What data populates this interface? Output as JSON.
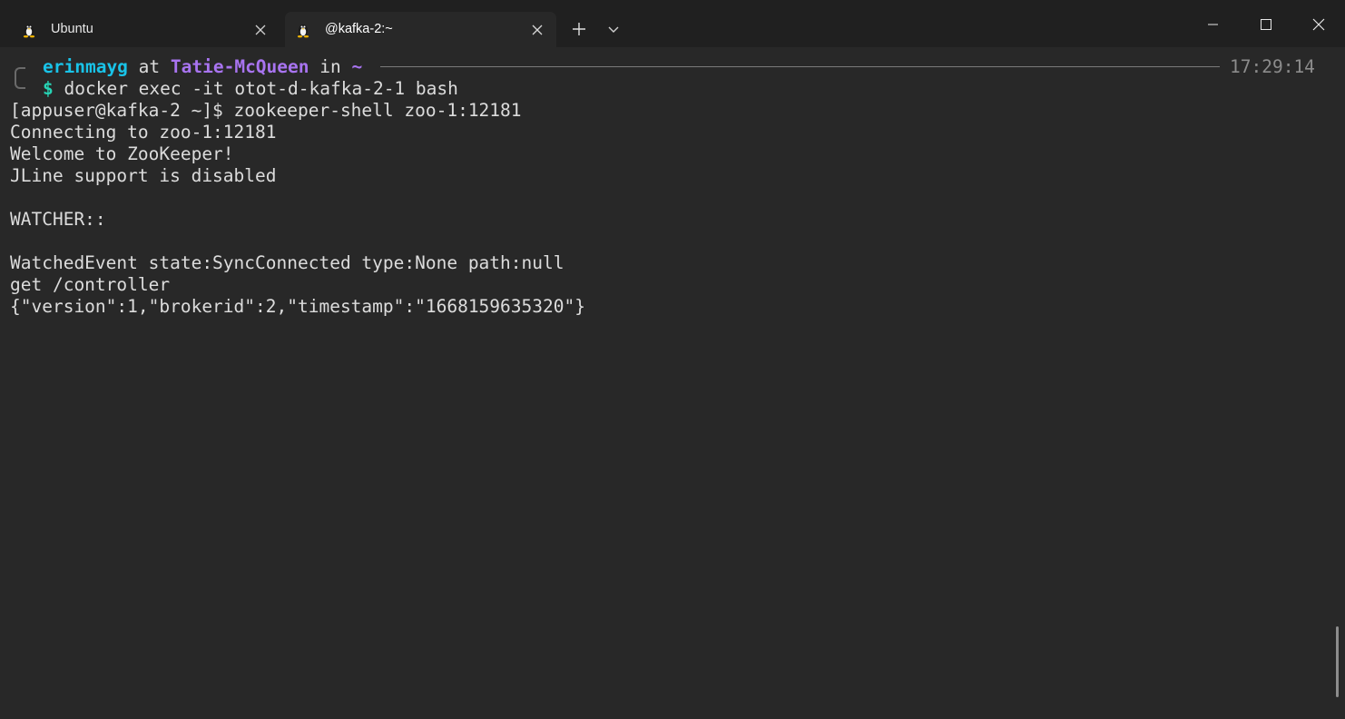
{
  "tabs": [
    {
      "label": "Ubuntu",
      "icon": "tux-icon",
      "active": false
    },
    {
      "label": "@kafka-2:~",
      "icon": "tux-icon",
      "active": true
    }
  ],
  "prompt": {
    "user": "erinmayg",
    "at": " at ",
    "host": "Tatie-McQueen",
    "in": " in ",
    "dir": "~",
    "time": "17:29:14",
    "dollar": "$",
    "command": " docker exec -it otot-d-kafka-2-1 bash"
  },
  "output_lines": [
    "[appuser@kafka-2 ~]$ zookeeper-shell zoo-1:12181",
    "Connecting to zoo-1:12181",
    "Welcome to ZooKeeper!",
    "JLine support is disabled",
    "",
    "WATCHER::",
    "",
    "WatchedEvent state:SyncConnected type:None path:null",
    "get /controller",
    "{\"version\":1,\"brokerid\":2,\"timestamp\":\"1668159635320\"}"
  ],
  "colors": {
    "terminal_bg": "#282828",
    "tabbar_bg": "#202020",
    "user": "#19c3e8",
    "host": "#a874f0",
    "dollar": "#27d3b4",
    "text": "#dcdcdc"
  }
}
